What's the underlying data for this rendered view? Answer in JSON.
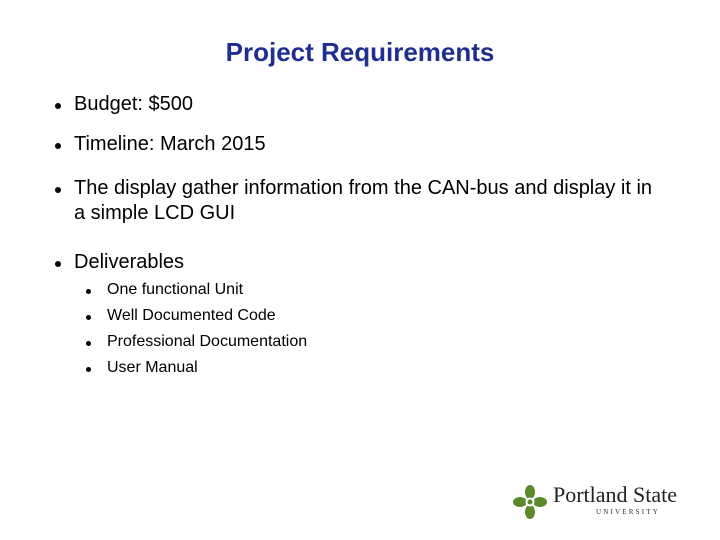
{
  "slide": {
    "title": "Project Requirements",
    "bullets": [
      {
        "text": "Budget: $500"
      },
      {
        "text": "Timeline: March 2015"
      },
      {
        "text": "The display gather information from the CAN-bus and display it in a simple LCD GUI"
      },
      {
        "text": "Deliverables"
      }
    ],
    "sub_bullets": [
      {
        "text": "One functional Unit"
      },
      {
        "text": "Well Documented Code"
      },
      {
        "text": "Professional Documentation"
      },
      {
        "text": "User Manual"
      }
    ],
    "title_color": "#1f2f8f"
  },
  "logo": {
    "name": "Portland State",
    "subtitle": "UNIVERSITY",
    "icon": "portland-state-leaf-icon",
    "color": "#5a8a2a"
  }
}
